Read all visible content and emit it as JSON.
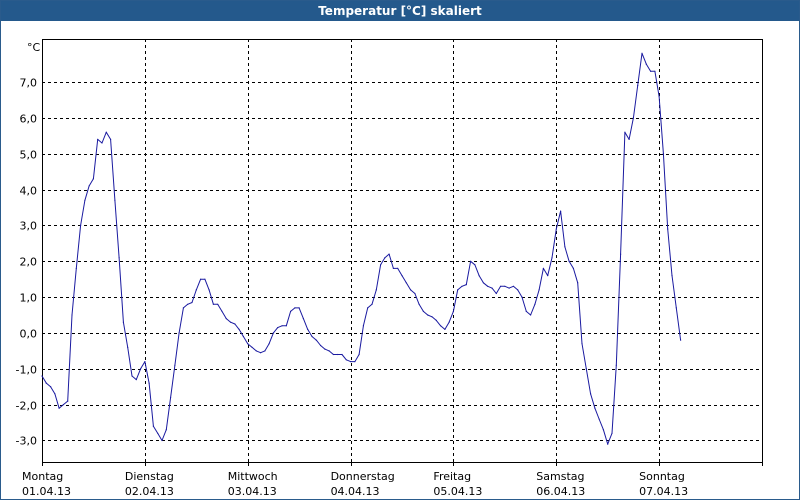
{
  "window": {
    "title": "Temperatur [°C] skaliert"
  },
  "chart_data": {
    "type": "line",
    "title": "Temperatur [°C] skaliert",
    "ylabel": "°C",
    "xlabel": "",
    "ylim": [
      -3.6,
      8.2
    ],
    "yticks": [
      -3.0,
      -2.0,
      -1.0,
      0.0,
      1.0,
      2.0,
      3.0,
      4.0,
      5.0,
      6.0,
      7.0
    ],
    "ytick_labels": [
      "-3,0",
      "-2,0",
      "-1,0",
      "0,0",
      "1,0",
      "2,0",
      "3,0",
      "4,0",
      "5,0",
      "6,0",
      "7,0"
    ],
    "xlim": [
      "2013-04-01 00:00",
      "2013-04-08 00:00"
    ],
    "days": [
      {
        "name": "Montag",
        "date": "01.04.13"
      },
      {
        "name": "Dienstag",
        "date": "02.04.13"
      },
      {
        "name": "Mittwoch",
        "date": "03.04.13"
      },
      {
        "name": "Donnerstag",
        "date": "04.04.13"
      },
      {
        "name": "Freitag",
        "date": "05.04.13"
      },
      {
        "name": "Samstag",
        "date": "06.04.13"
      },
      {
        "name": "Sonntag",
        "date": "07.04.13"
      }
    ],
    "grid": true,
    "grid_style": "dashed",
    "series": [
      {
        "color": "#1a1aa0",
        "points": [
          [
            "2013-04-01 00:00",
            -1.2
          ],
          [
            "2013-04-01 01:00",
            -1.4
          ],
          [
            "2013-04-01 02:00",
            -1.5
          ],
          [
            "2013-04-01 03:00",
            -1.7
          ],
          [
            "2013-04-01 04:00",
            -2.1
          ],
          [
            "2013-04-01 05:00",
            -2.0
          ],
          [
            "2013-04-01 06:00",
            -1.9
          ],
          [
            "2013-04-01 07:00",
            0.5
          ],
          [
            "2013-04-01 08:00",
            1.8
          ],
          [
            "2013-04-01 09:00",
            3.0
          ],
          [
            "2013-04-01 10:00",
            3.7
          ],
          [
            "2013-04-01 11:00",
            4.1
          ],
          [
            "2013-04-01 12:00",
            4.3
          ],
          [
            "2013-04-01 13:00",
            5.4
          ],
          [
            "2013-04-01 14:00",
            5.3
          ],
          [
            "2013-04-01 15:00",
            5.6
          ],
          [
            "2013-04-01 16:00",
            5.4
          ],
          [
            "2013-04-01 17:00",
            3.7
          ],
          [
            "2013-04-01 18:00",
            2.1
          ],
          [
            "2013-04-01 19:00",
            0.3
          ],
          [
            "2013-04-01 20:00",
            -0.4
          ],
          [
            "2013-04-01 21:00",
            -1.2
          ],
          [
            "2013-04-01 22:00",
            -1.3
          ],
          [
            "2013-04-01 23:00",
            -1.0
          ],
          [
            "2013-04-02 00:00",
            -0.8
          ],
          [
            "2013-04-02 01:00",
            -1.4
          ],
          [
            "2013-04-02 02:00",
            -2.6
          ],
          [
            "2013-04-02 03:00",
            -2.8
          ],
          [
            "2013-04-02 04:00",
            -3.0
          ],
          [
            "2013-04-02 05:00",
            -2.7
          ],
          [
            "2013-04-02 06:00",
            -1.8
          ],
          [
            "2013-04-02 07:00",
            -0.9
          ],
          [
            "2013-04-02 08:00",
            0.0
          ],
          [
            "2013-04-02 09:00",
            0.7
          ],
          [
            "2013-04-02 10:00",
            0.8
          ],
          [
            "2013-04-02 11:00",
            0.85
          ],
          [
            "2013-04-02 12:00",
            1.2
          ],
          [
            "2013-04-02 13:00",
            1.5
          ],
          [
            "2013-04-02 14:00",
            1.5
          ],
          [
            "2013-04-02 15:00",
            1.2
          ],
          [
            "2013-04-02 16:00",
            0.8
          ],
          [
            "2013-04-02 17:00",
            0.8
          ],
          [
            "2013-04-02 18:00",
            0.6
          ],
          [
            "2013-04-02 19:00",
            0.4
          ],
          [
            "2013-04-02 20:00",
            0.3
          ],
          [
            "2013-04-02 21:00",
            0.25
          ],
          [
            "2013-04-02 22:00",
            0.1
          ],
          [
            "2013-04-02 23:00",
            -0.1
          ],
          [
            "2013-04-03 00:00",
            -0.3
          ],
          [
            "2013-04-03 01:00",
            -0.4
          ],
          [
            "2013-04-03 02:00",
            -0.5
          ],
          [
            "2013-04-03 03:00",
            -0.55
          ],
          [
            "2013-04-03 04:00",
            -0.5
          ],
          [
            "2013-04-03 05:00",
            -0.3
          ],
          [
            "2013-04-03 06:00",
            0.0
          ],
          [
            "2013-04-03 07:00",
            0.15
          ],
          [
            "2013-04-03 08:00",
            0.2
          ],
          [
            "2013-04-03 09:00",
            0.2
          ],
          [
            "2013-04-03 10:00",
            0.6
          ],
          [
            "2013-04-03 11:00",
            0.7
          ],
          [
            "2013-04-03 12:00",
            0.7
          ],
          [
            "2013-04-03 13:00",
            0.4
          ],
          [
            "2013-04-03 14:00",
            0.1
          ],
          [
            "2013-04-03 15:00",
            -0.1
          ],
          [
            "2013-04-03 16:00",
            -0.2
          ],
          [
            "2013-04-03 17:00",
            -0.35
          ],
          [
            "2013-04-03 18:00",
            -0.45
          ],
          [
            "2013-04-03 19:00",
            -0.5
          ],
          [
            "2013-04-03 20:00",
            -0.6
          ],
          [
            "2013-04-03 21:00",
            -0.6
          ],
          [
            "2013-04-03 22:00",
            -0.6
          ],
          [
            "2013-04-03 23:00",
            -0.75
          ],
          [
            "2013-04-04 00:00",
            -0.8
          ],
          [
            "2013-04-04 01:00",
            -0.8
          ],
          [
            "2013-04-04 02:00",
            -0.6
          ],
          [
            "2013-04-04 03:00",
            0.2
          ],
          [
            "2013-04-04 04:00",
            0.7
          ],
          [
            "2013-04-04 05:00",
            0.8
          ],
          [
            "2013-04-04 06:00",
            1.2
          ],
          [
            "2013-04-04 07:00",
            1.9
          ],
          [
            "2013-04-04 08:00",
            2.1
          ],
          [
            "2013-04-04 09:00",
            2.2
          ],
          [
            "2013-04-04 10:00",
            1.8
          ],
          [
            "2013-04-04 11:00",
            1.8
          ],
          [
            "2013-04-04 12:00",
            1.6
          ],
          [
            "2013-04-04 13:00",
            1.4
          ],
          [
            "2013-04-04 14:00",
            1.2
          ],
          [
            "2013-04-04 15:00",
            1.1
          ],
          [
            "2013-04-04 16:00",
            0.8
          ],
          [
            "2013-04-04 17:00",
            0.6
          ],
          [
            "2013-04-04 18:00",
            0.5
          ],
          [
            "2013-04-04 19:00",
            0.45
          ],
          [
            "2013-04-04 20:00",
            0.35
          ],
          [
            "2013-04-04 21:00",
            0.2
          ],
          [
            "2013-04-04 22:00",
            0.1
          ],
          [
            "2013-04-04 23:00",
            0.3
          ],
          [
            "2013-04-05 00:00",
            0.6
          ],
          [
            "2013-04-05 01:00",
            1.2
          ],
          [
            "2013-04-05 02:00",
            1.3
          ],
          [
            "2013-04-05 03:00",
            1.35
          ],
          [
            "2013-04-05 04:00",
            2.0
          ],
          [
            "2013-04-05 05:00",
            1.9
          ],
          [
            "2013-04-05 06:00",
            1.6
          ],
          [
            "2013-04-05 07:00",
            1.4
          ],
          [
            "2013-04-05 08:00",
            1.3
          ],
          [
            "2013-04-05 09:00",
            1.25
          ],
          [
            "2013-04-05 10:00",
            1.1
          ],
          [
            "2013-04-05 11:00",
            1.3
          ],
          [
            "2013-04-05 12:00",
            1.3
          ],
          [
            "2013-04-05 13:00",
            1.25
          ],
          [
            "2013-04-05 14:00",
            1.3
          ],
          [
            "2013-04-05 15:00",
            1.2
          ],
          [
            "2013-04-05 16:00",
            1.0
          ],
          [
            "2013-04-05 17:00",
            0.6
          ],
          [
            "2013-04-05 18:00",
            0.5
          ],
          [
            "2013-04-05 19:00",
            0.8
          ],
          [
            "2013-04-05 20:00",
            1.2
          ],
          [
            "2013-04-05 21:00",
            1.8
          ],
          [
            "2013-04-05 22:00",
            1.6
          ],
          [
            "2013-04-05 23:00",
            2.1
          ],
          [
            "2013-04-06 00:00",
            2.9
          ],
          [
            "2013-04-06 01:00",
            3.4
          ],
          [
            "2013-04-06 02:00",
            2.4
          ],
          [
            "2013-04-06 03:00",
            2.0
          ],
          [
            "2013-04-06 04:00",
            1.8
          ],
          [
            "2013-04-06 05:00",
            1.4
          ],
          [
            "2013-04-06 06:00",
            -0.3
          ],
          [
            "2013-04-06 07:00",
            -1.0
          ],
          [
            "2013-04-06 08:00",
            -1.7
          ],
          [
            "2013-04-06 09:00",
            -2.1
          ],
          [
            "2013-04-06 10:00",
            -2.4
          ],
          [
            "2013-04-06 11:00",
            -2.7
          ],
          [
            "2013-04-06 12:00",
            -3.1
          ],
          [
            "2013-04-06 13:00",
            -2.8
          ],
          [
            "2013-04-06 14:00",
            -0.9
          ],
          [
            "2013-04-06 15:00",
            2.2
          ],
          [
            "2013-04-06 16:00",
            5.6
          ],
          [
            "2013-04-06 17:00",
            5.4
          ],
          [
            "2013-04-06 18:00",
            6.0
          ],
          [
            "2013-04-06 19:00",
            6.9
          ],
          [
            "2013-04-06 20:00",
            7.8
          ],
          [
            "2013-04-06 21:00",
            7.5
          ],
          [
            "2013-04-06 22:00",
            7.3
          ],
          [
            "2013-04-06 23:00",
            7.3
          ],
          [
            "2013-04-07 00:00",
            6.6
          ],
          [
            "2013-04-07 01:00",
            5.0
          ],
          [
            "2013-04-07 02:00",
            2.9
          ],
          [
            "2013-04-07 03:00",
            1.6
          ],
          [
            "2013-04-07 04:00",
            0.7
          ],
          [
            "2013-04-07 05:00",
            -0.2
          ]
        ]
      }
    ]
  }
}
